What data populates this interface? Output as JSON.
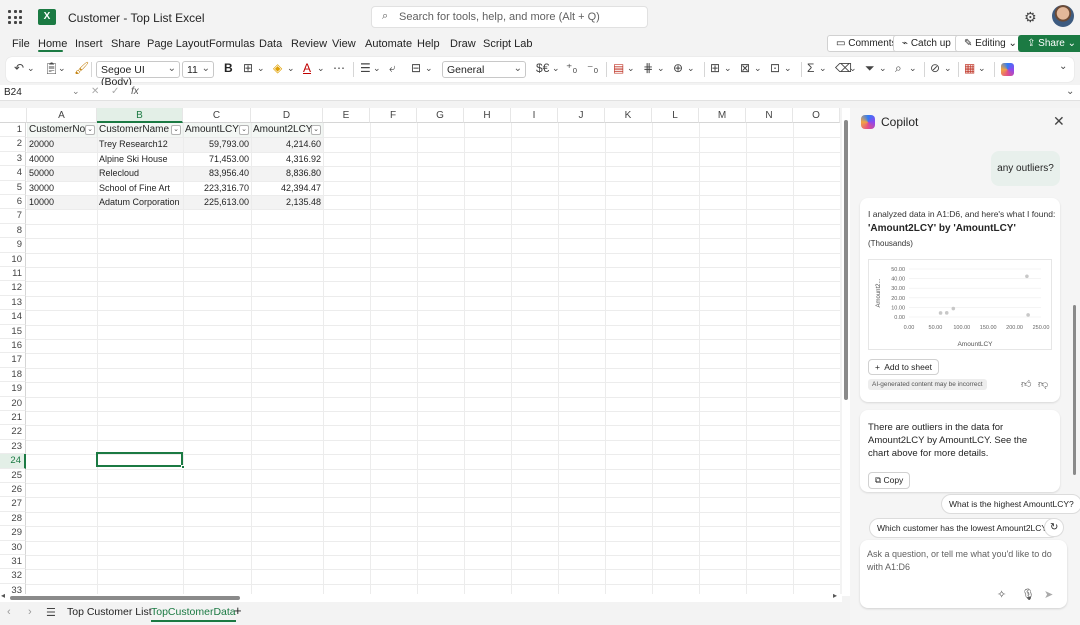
{
  "app": {
    "title": "Customer - Top List Excel",
    "search_placeholder": "Search for tools, help, and more (Alt + Q)"
  },
  "menu": {
    "items": [
      "File",
      "Home",
      "Insert",
      "Share",
      "Page Layout",
      "Formulas",
      "Data",
      "Review",
      "View",
      "Automate",
      "Help",
      "Draw",
      "Script Lab"
    ],
    "active": "Home",
    "comments": "Comments",
    "catchup": "Catch up",
    "editing": "Editing",
    "share": "Share"
  },
  "ribbon": {
    "font_name": "Segoe UI (Body)",
    "font_size": "11",
    "bold": "B",
    "number_format": "General"
  },
  "formula_bar": {
    "name_box": "B24",
    "fx": "fx",
    "value": ""
  },
  "grid": {
    "columns": [
      "A",
      "B",
      "C",
      "D",
      "E",
      "F",
      "G",
      "H",
      "I",
      "J",
      "K",
      "L",
      "M",
      "N",
      "O"
    ],
    "selected_column": "B",
    "rows": [
      "1",
      "2",
      "3",
      "4",
      "5",
      "6",
      "7",
      "8",
      "9",
      "10",
      "11",
      "12",
      "13",
      "14",
      "15",
      "16",
      "17",
      "18",
      "19",
      "20",
      "21",
      "22",
      "23",
      "24",
      "25",
      "26",
      "27",
      "28",
      "29",
      "30",
      "31",
      "32",
      "33"
    ],
    "selected_row": "24",
    "table_headers": [
      "CustomerNo",
      "CustomerName",
      "AmountLCY",
      "Amount2LCY"
    ],
    "table_rows": [
      [
        "20000",
        "Trey Research12",
        "59,793.00",
        "4,214.60"
      ],
      [
        "40000",
        "Alpine Ski House",
        "71,453.00",
        "4,316.92"
      ],
      [
        "50000",
        "Relecloud",
        "83,956.40",
        "8,836.80"
      ],
      [
        "30000",
        "School of Fine Art",
        "223,316.70",
        "42,394.47"
      ],
      [
        "10000",
        "Adatum Corporation",
        "225,613.00",
        "2,135.48"
      ]
    ]
  },
  "sheets": {
    "tabs": [
      "Top Customer List",
      "TopCustomerData"
    ],
    "active": "TopCustomerData",
    "add": "+"
  },
  "copilot": {
    "title": "Copilot",
    "user_message": "any outliers?",
    "analysis_intro": "I analyzed data in A1:D6, and here's what I found:",
    "chart_title": "'Amount2LCY' by 'AmountLCY'",
    "chart_subtitle": "(Thousands)",
    "add_to_sheet": "Add to sheet",
    "ai_disclaimer": "AI-generated content may be incorrect",
    "outlier_message": "There are outliers in the data for Amount2LCY by AmountLCY. See the chart above for more details.",
    "copy": "Copy",
    "suggestions": [
      "What is the highest AmountLCY?",
      "Which customer has the lowest Amount2LCY?"
    ],
    "input_placeholder": "Ask a question, or tell me what you'd like to do with A1:D6"
  },
  "chart_data": {
    "type": "scatter",
    "title": "'Amount2LCY' by 'AmountLCY'",
    "subtitle": "(Thousands)",
    "xlabel": "AmountLCY",
    "ylabel": "Amount2...",
    "x_ticks": [
      "0.00",
      "50.00",
      "100.00",
      "150.00",
      "200.00",
      "250.00"
    ],
    "y_ticks": [
      "0.00",
      "10.00",
      "20.00",
      "30.00",
      "40.00",
      "50.00"
    ],
    "xlim": [
      0,
      250
    ],
    "ylim": [
      0,
      50
    ],
    "grid": true,
    "points": [
      {
        "x": 59.79,
        "y": 4.21
      },
      {
        "x": 71.45,
        "y": 4.32
      },
      {
        "x": 83.96,
        "y": 8.84
      },
      {
        "x": 223.32,
        "y": 42.39
      },
      {
        "x": 225.61,
        "y": 2.14
      }
    ],
    "color": "#c8c8c8"
  }
}
